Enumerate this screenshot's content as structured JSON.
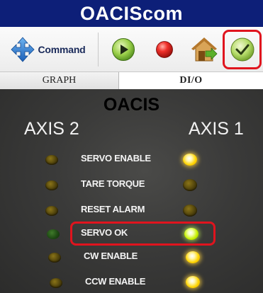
{
  "window": {
    "title": "OACIScom"
  },
  "toolbar": {
    "command_label": "Command",
    "icons": {
      "command": "move-arrows-icon",
      "play": "play-icon",
      "stop": "record-stop-icon",
      "home": "home-arrow-icon",
      "ok": "checkmark-icon"
    },
    "highlight_color": "#e0141e"
  },
  "tabs": [
    {
      "label": "GRAPH",
      "active": false
    },
    {
      "label": "DI/O",
      "active": true
    }
  ],
  "panel": {
    "title": "OACIS",
    "axis_left": "AXIS 2",
    "axis_right": "AXIS 1",
    "signals": [
      {
        "label": "SERVO ENABLE",
        "axis2": "off",
        "axis1": "on-yellow"
      },
      {
        "label": "TARE TORQUE",
        "axis2": "off",
        "axis1": "off"
      },
      {
        "label": "RESET ALARM",
        "axis2": "off",
        "axis1": "off"
      },
      {
        "label": "SERVO OK",
        "axis2": "off-green",
        "axis1": "on-green",
        "highlighted": true
      },
      {
        "label": "CW ENABLE",
        "axis2": "off",
        "axis1": "on-yellow"
      },
      {
        "label": "CCW ENABLE",
        "axis2": "off",
        "axis1": "on-yellow"
      }
    ]
  }
}
